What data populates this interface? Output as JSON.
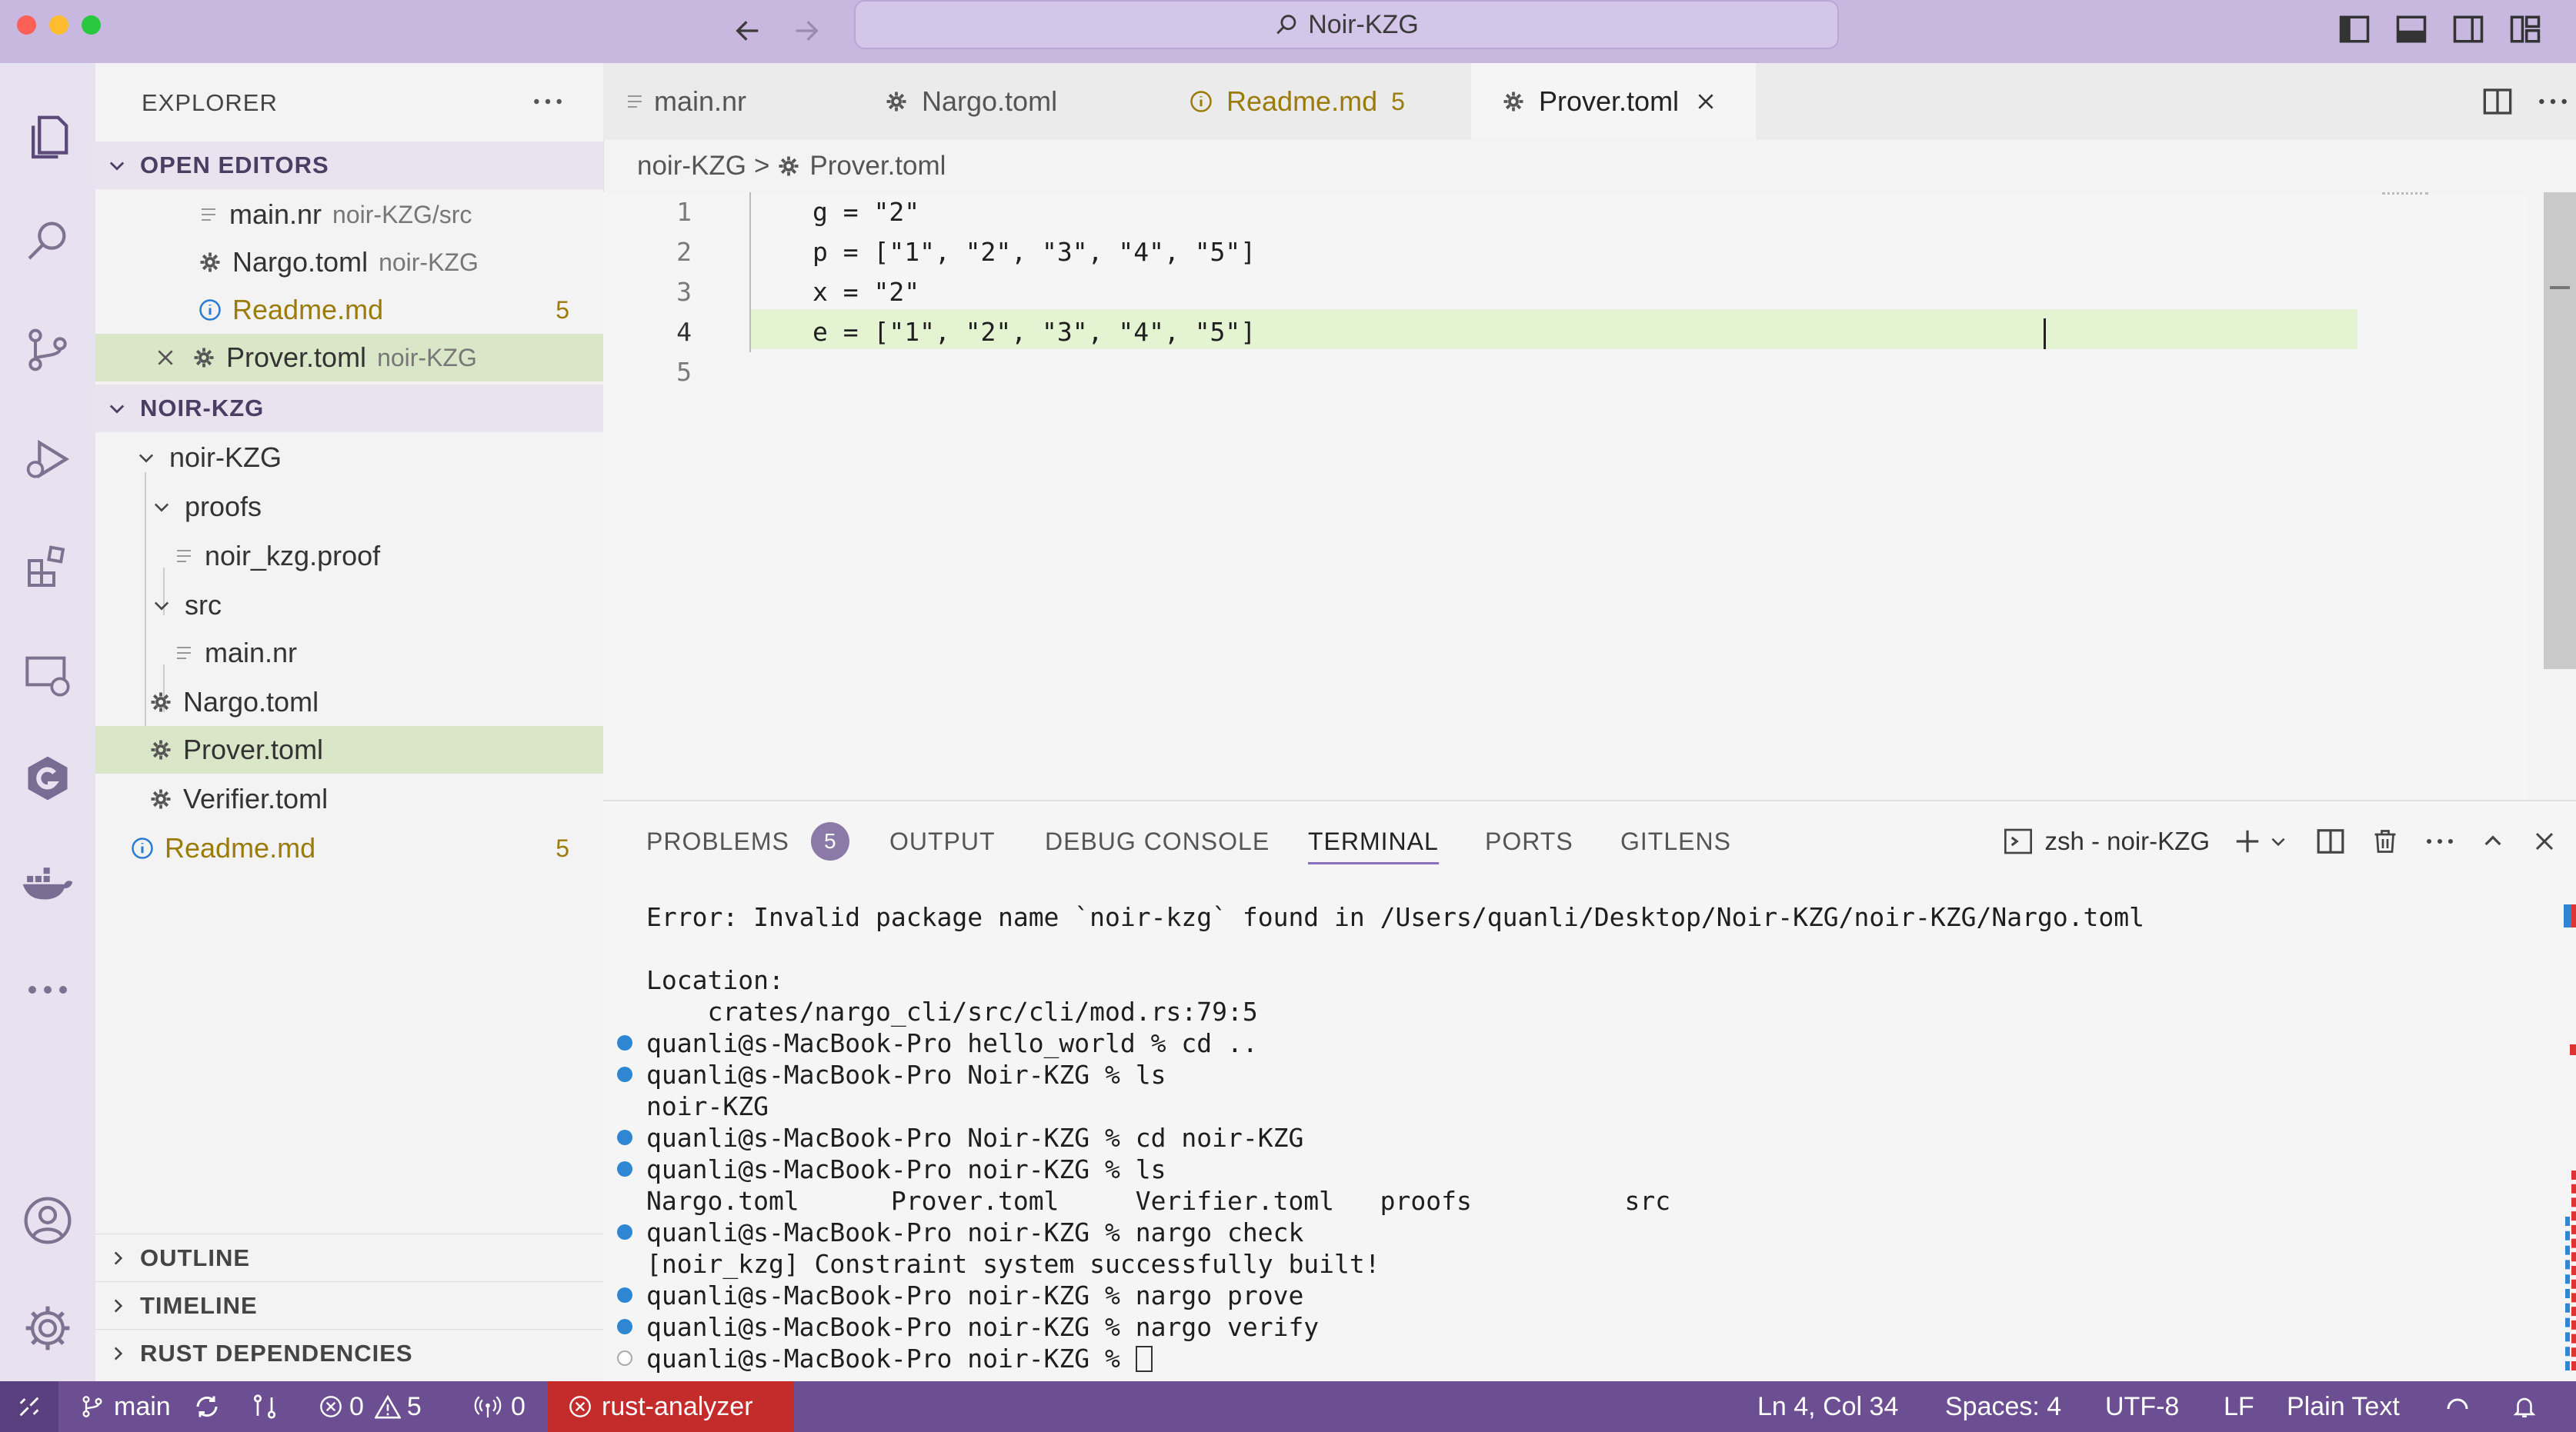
{
  "window": {
    "title": "Noir-KZG"
  },
  "explorer": {
    "title": "EXPLORER",
    "open_editors_label": "OPEN EDITORS",
    "open_editors": [
      {
        "name": "main.nr",
        "path": "noir-KZG/src"
      },
      {
        "name": "Nargo.toml",
        "path": "noir-KZG"
      },
      {
        "name": "Readme.md",
        "path": "",
        "badge": "5"
      },
      {
        "name": "Prover.toml",
        "path": "noir-KZG"
      }
    ],
    "project_label": "NOIR-KZG",
    "tree": {
      "root": "noir-KZG",
      "proofs": "proofs",
      "proof_file": "noir_kzg.proof",
      "src": "src",
      "main": "main.nr",
      "nargo": "Nargo.toml",
      "prover": "Prover.toml",
      "verifier": "Verifier.toml",
      "readme": "Readme.md",
      "readme_badge": "5"
    },
    "bottom_sections": [
      "OUTLINE",
      "TIMELINE",
      "RUST DEPENDENCIES"
    ]
  },
  "tabs": [
    {
      "label": "main.nr"
    },
    {
      "label": "Nargo.toml"
    },
    {
      "label": "Readme.md",
      "badge": "5"
    },
    {
      "label": "Prover.toml"
    }
  ],
  "breadcrumb": {
    "folder": "noir-KZG",
    "sep": ">",
    "file": "Prover.toml"
  },
  "editor": {
    "line_numbers": [
      "1",
      "2",
      "3",
      "4",
      "5"
    ],
    "lines": [
      "g = \"2\"",
      "p = [\"1\", \"2\", \"3\", \"4\", \"5\"]",
      "x = \"2\"",
      "e = [\"1\", \"2\", \"3\", \"4\", \"5\"]",
      ""
    ]
  },
  "panel": {
    "tabs": [
      "PROBLEMS",
      "OUTPUT",
      "DEBUG CONSOLE",
      "TERMINAL",
      "PORTS",
      "GITLENS"
    ],
    "problems_count": "5",
    "terminal_name": "zsh - noir-KZG",
    "terminal_lines": [
      "Error: Invalid package name `noir-kzg` found in /Users/quanli/Desktop/Noir-KZG/noir-KZG/Nargo.toml",
      "",
      "Location:",
      "    crates/nargo_cli/src/cli/mod.rs:79:5",
      "quanli@s-MacBook-Pro hello_world % cd ..",
      "quanli@s-MacBook-Pro Noir-KZG % ls",
      "noir-KZG",
      "quanli@s-MacBook-Pro Noir-KZG % cd noir-KZG",
      "quanli@s-MacBook-Pro noir-KZG % ls",
      "Nargo.toml      Prover.toml     Verifier.toml   proofs          src",
      "quanli@s-MacBook-Pro noir-KZG % nargo check",
      "[noir_kzg] Constraint system successfully built!",
      "quanli@s-MacBook-Pro noir-KZG % nargo prove",
      "quanli@s-MacBook-Pro noir-KZG % nargo verify",
      "quanli@s-MacBook-Pro noir-KZG % "
    ]
  },
  "statusbar": {
    "branch": "main",
    "errors": "0",
    "warnings": "5",
    "ports": "0",
    "rust_analyzer": "rust-analyzer",
    "position": "Ln 4, Col 34",
    "spaces": "Spaces: 4",
    "encoding": "UTF-8",
    "eol": "LF",
    "language": "Plain Text"
  },
  "colors": {
    "titlebar": "#c8b8e0",
    "statusbar": "#6c4f92",
    "rust_analyzer_bg": "#c42b2b",
    "selection": "#d9e6c8",
    "current_line": "#e4f3d2",
    "warning_gold": "#9b7b0a",
    "terminal_dot": "#2f86d2"
  }
}
